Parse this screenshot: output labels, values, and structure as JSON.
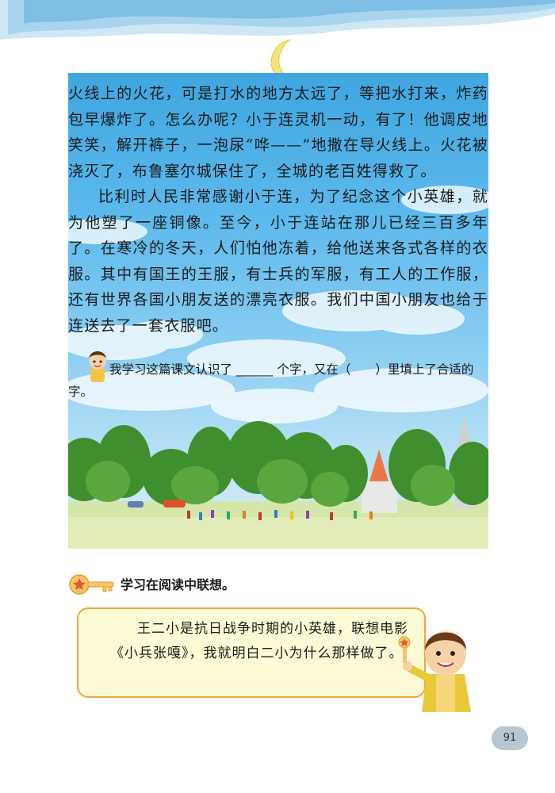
{
  "story": {
    "paragraph1": "火线上的火花，可是打水的地方太远了，等把水打来，炸药包早爆炸了。怎么办呢？小于连灵机一动，有了！他调皮地笑笑，解开裤子，一泡尿“哗——”地撒在导火线上。火花被浇灭了，布鲁塞尔城保住了，全城的老百姓得救了。",
    "paragraph2": "比利时人民非常感谢小于连，为了纪念这个小英雄，就为他塑了一座铜像。至今，小于连站在那儿已经三百多年了。在寒冷的冬天，人们怕他冻着，给他送来各式各样的衣服。其中有国王的王服，有士兵的军服，有工人的工作服，还有世界各国小朋友送的漂亮衣服。我们中国小朋友也给于连送去了一套衣服吧。"
  },
  "exercise": {
    "text": "我学习这篇课文认识了 ______ 个字，又在（　　）里填上了合适的字。"
  },
  "tip": {
    "title": "学习在阅读中联想。",
    "bubble_text": "王二小是抗日战争时期的小英雄，联想电影《小兵张嘎》，我就明白二小为什么那样做了。"
  },
  "page_number": "91"
}
